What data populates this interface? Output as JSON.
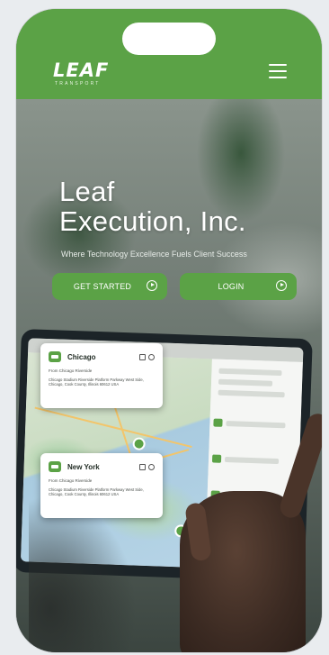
{
  "header": {
    "logo_main": "LEAF",
    "logo_sub": "TRANSPORT",
    "menu_icon": "hamburger-menu-icon"
  },
  "hero": {
    "title_line1": "Leaf",
    "title_line2": "Execution, Inc.",
    "subtitle": "Where Technology Excellence Fuels Client Success",
    "buttons": {
      "get_started": "GET STARTED",
      "login": "LOGIN"
    }
  },
  "map_cards": [
    {
      "city": "Chicago",
      "subtitle": "From Chicago Riverside",
      "body": "Chicago Stadium Riverside Platform Parkway West Side, Chicago, Cook County, Illinois 60612 USA"
    },
    {
      "city": "New York",
      "subtitle": "From Chicago Riverside",
      "body": "Chicago Stadium Riverside Platform Parkway West Side, Chicago, Cook County, Illinois 60612 USA"
    }
  ],
  "colors": {
    "brand_green": "#5ba246",
    "text_white": "#ffffff"
  }
}
